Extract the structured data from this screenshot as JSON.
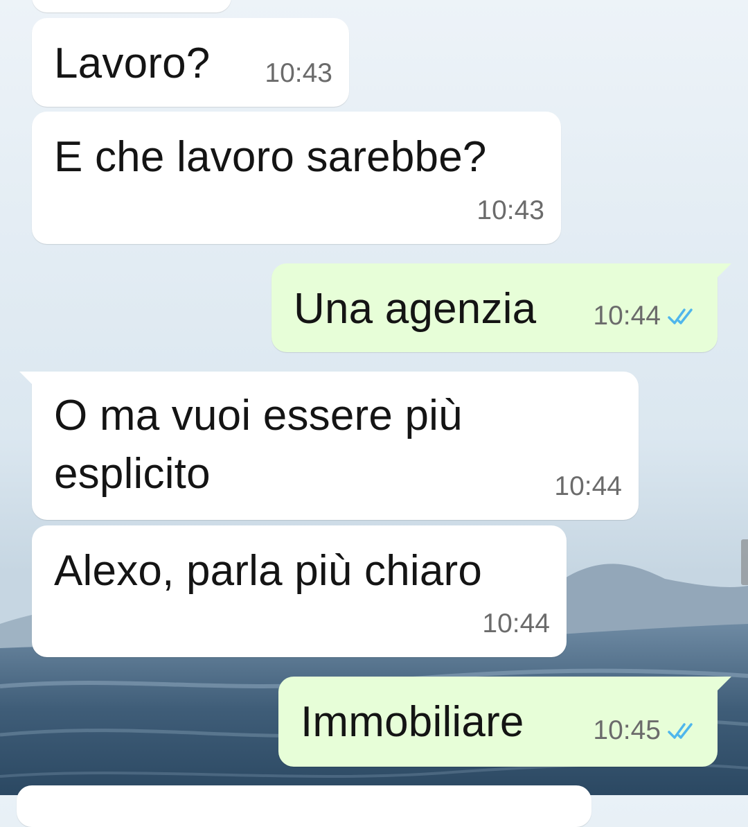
{
  "messages": [
    {
      "text": "Lavoro?",
      "time": "10:43",
      "direction": "in"
    },
    {
      "text": "E che lavoro sarebbe?",
      "time": "10:43",
      "direction": "in"
    },
    {
      "text": "Una agenzia",
      "time": "10:44",
      "direction": "out",
      "status": "read"
    },
    {
      "text": "O ma vuoi essere più esplicito",
      "time": "10:44",
      "direction": "in"
    },
    {
      "text": "Alexo, parla più chiaro",
      "time": "10:44",
      "direction": "in"
    },
    {
      "text": "Immobiliare",
      "time": "10:45",
      "direction": "out",
      "status": "read"
    }
  ],
  "colors": {
    "incoming_bubble": "#ffffff",
    "outgoing_bubble": "#e7fed8",
    "read_ticks": "#4fb6ec",
    "timestamp": "#6b6b6b"
  },
  "icons": {
    "read_status": "double-check-icon"
  }
}
